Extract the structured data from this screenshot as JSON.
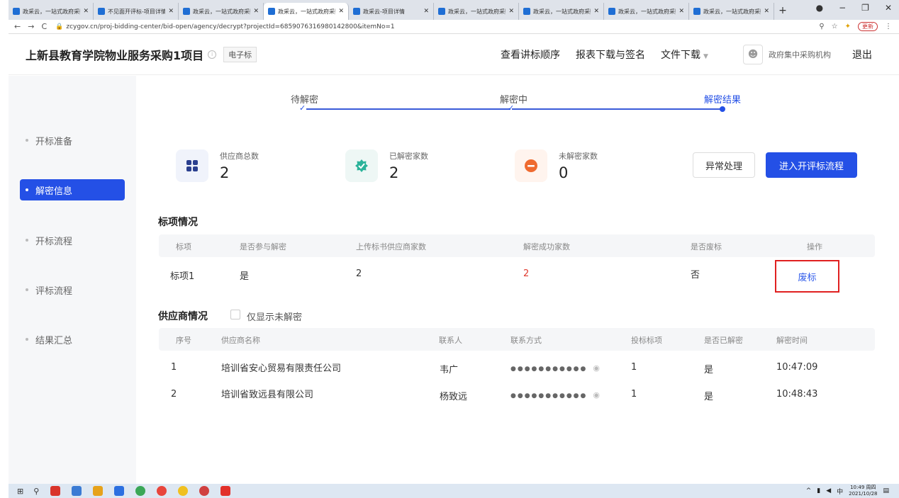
{
  "browser": {
    "tabs": [
      {
        "title": "政采云，一站式政府采购",
        "active": false
      },
      {
        "title": "不见面开评标-项目详情",
        "active": false
      },
      {
        "title": "政采云，一站式政府采购",
        "active": false
      },
      {
        "title": "政采云，一站式政府采购",
        "active": true
      },
      {
        "title": "政采云-项目详情",
        "active": false
      },
      {
        "title": "政采云，一站式政府采购",
        "active": false
      },
      {
        "title": "政采云，一站式政府采购",
        "active": false
      },
      {
        "title": "政采云，一站式政府采购",
        "active": false
      },
      {
        "title": "政采云，一站式政府采购",
        "active": false
      }
    ],
    "new_tab": "+",
    "url": "zcygov.cn/proj-bidding-center/bid-open/agency/decrypt?projectId=6859076316980142800&itemNo=1",
    "renew_label": "更新"
  },
  "header": {
    "title": "上新县教育学院物业服务采购1项目",
    "tag": "电子标",
    "nav": [
      "查看讲标顺序",
      "报表下载与签名",
      "文件下载"
    ],
    "org": "政府集中采购机构",
    "logout": "退出"
  },
  "sidebar": {
    "items": [
      {
        "label": "开标准备",
        "active": false
      },
      {
        "label": "解密信息",
        "active": true
      },
      {
        "label": "开标流程",
        "active": false
      },
      {
        "label": "评标流程",
        "active": false
      },
      {
        "label": "结果汇总",
        "active": false
      }
    ]
  },
  "steps": [
    "待解密",
    "解密中",
    "解密结果"
  ],
  "stats": [
    {
      "label": "供应商总数",
      "value": "2",
      "icon": "grid-icon"
    },
    {
      "label": "已解密家数",
      "value": "2",
      "icon": "check-badge-icon"
    },
    {
      "label": "未解密家数",
      "value": "0",
      "icon": "minus-icon"
    }
  ],
  "actions": {
    "exception": "异常处理",
    "enter": "进入开评标流程"
  },
  "lots": {
    "title": "标项情况",
    "columns": [
      "标项",
      "是否参与解密",
      "上传标书供应商家数",
      "解密成功家数",
      "是否废标",
      "操作"
    ],
    "rows": [
      {
        "lot": "标项1",
        "participate": "是",
        "uploaded": "2",
        "success": "2",
        "abandoned": "否",
        "action": "废标"
      }
    ]
  },
  "suppliers": {
    "title": "供应商情况",
    "filter_label": "仅显示未解密",
    "columns": [
      "序号",
      "供应商名称",
      "联系人",
      "联系方式",
      "投标标项",
      "是否已解密",
      "解密时间"
    ],
    "rows": [
      {
        "no": "1",
        "name": "培训省安心贸易有限责任公司",
        "contact": "韦广",
        "phone": "●●●●●●●●●●●",
        "lot": "1",
        "decrypted": "是",
        "time": "10:47:09"
      },
      {
        "no": "2",
        "name": "培训省致远县有限公司",
        "contact": "杨致远",
        "phone": "●●●●●●●●●●●",
        "lot": "1",
        "decrypted": "是",
        "time": "10:48:43"
      }
    ]
  },
  "taskbar": {
    "ime": "中",
    "time": "10:49 周四",
    "date": "2021/10/28"
  }
}
